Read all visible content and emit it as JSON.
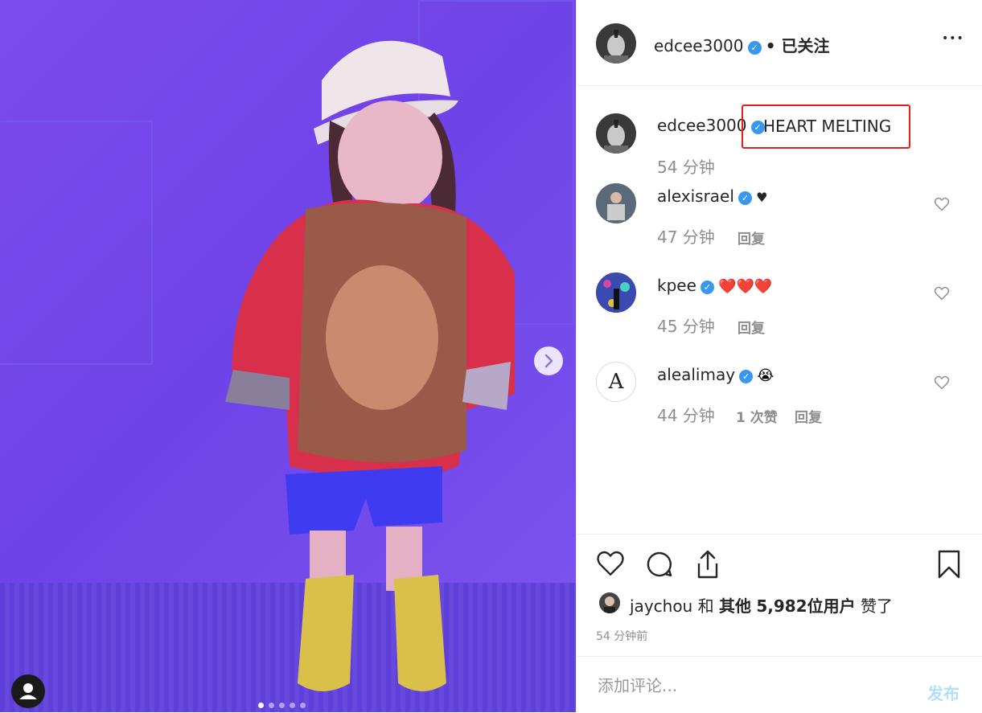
{
  "post": {
    "author": "edcee3000",
    "follow_status": "• 已关注",
    "more_label": "•••",
    "caption_author": "edcee3000",
    "caption": "HEART MELTING",
    "caption_time": "54 分钟"
  },
  "comments": [
    {
      "user": "alexisrael",
      "text": "♥",
      "time": "47 分钟",
      "likes": "",
      "reply": "回复"
    },
    {
      "user": "kpee",
      "text": "❤️❤️❤️",
      "time": "45 分钟",
      "likes": "",
      "reply": "回复"
    },
    {
      "user": "alealimay",
      "text": "😭",
      "time": "44 分钟",
      "likes": "1 次赞",
      "reply": "回复"
    }
  ],
  "likes": {
    "user": "jaychou",
    "and": "和",
    "others": "其他",
    "count": "5,982",
    "users_label": "位用户",
    "liked": "赞了"
  },
  "post_time": "54 分钟前",
  "add_comment": {
    "placeholder": "添加评论...",
    "post_label": "发布"
  },
  "carousel": {
    "count": 5,
    "active": 0
  },
  "colors": {
    "verified": "#3897f0",
    "text": "#262626",
    "muted": "#8e8e8e",
    "highlight": "#e0201a",
    "post_button": "#b2dffc"
  },
  "icons": [
    "verified-icon",
    "more-icon",
    "heart-icon",
    "comment-icon",
    "share-icon",
    "bookmark-icon",
    "next-arrow-icon",
    "profile-icon"
  ]
}
